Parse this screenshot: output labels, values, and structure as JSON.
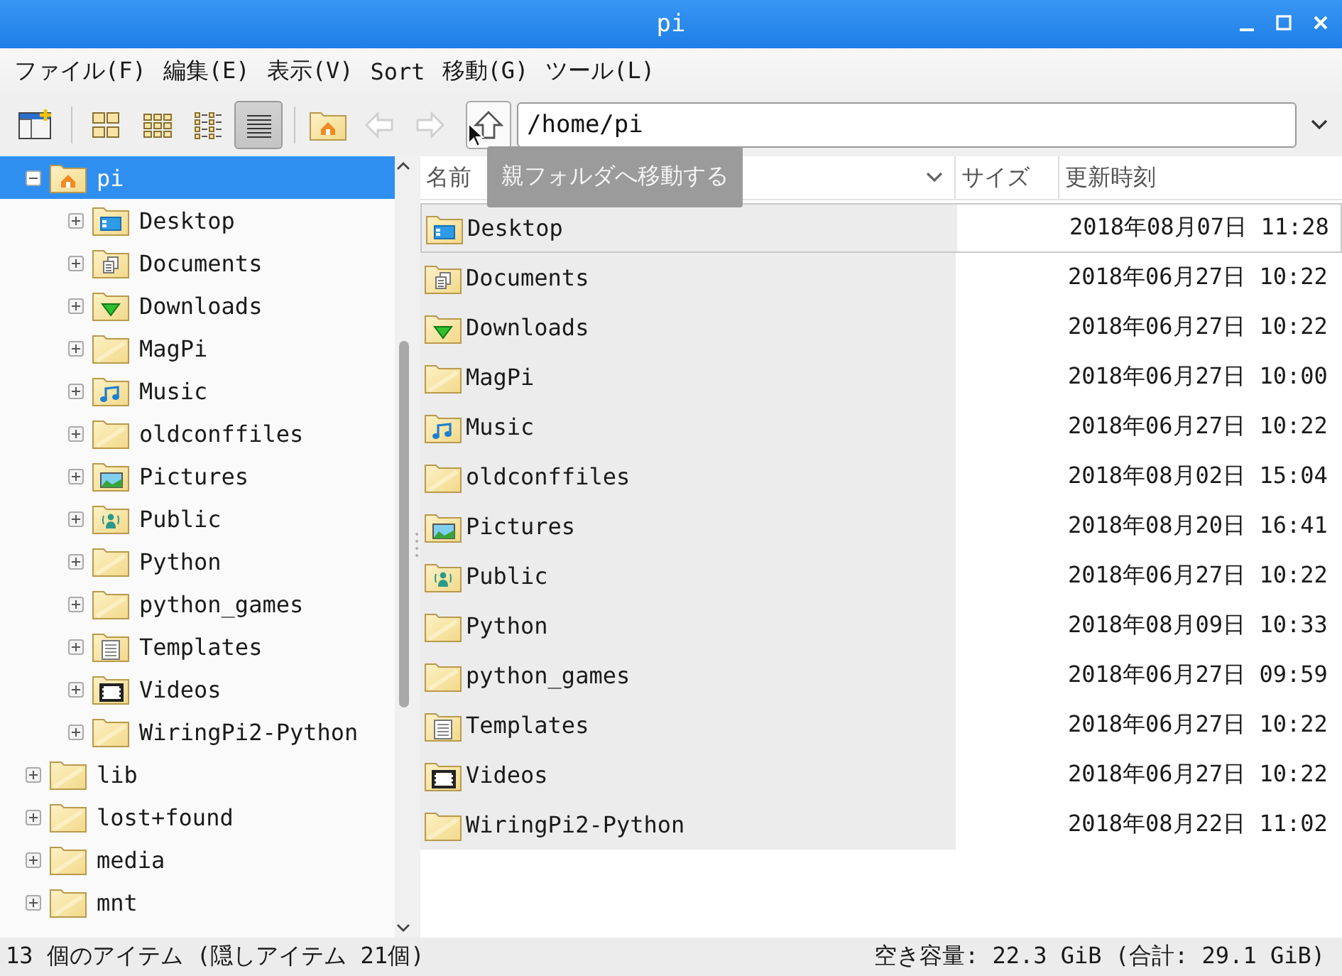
{
  "window": {
    "title": "pi"
  },
  "menu": [
    "ファイル(F)",
    "編集(E)",
    "表示(V)",
    "Sort",
    "移動(G)",
    "ツール(L)"
  ],
  "toolbar": {
    "view_modes": [
      {
        "kind": "icons",
        "selected": false
      },
      {
        "kind": "thumbnails",
        "selected": false
      },
      {
        "kind": "compact",
        "selected": false
      },
      {
        "kind": "detailed",
        "selected": true
      }
    ],
    "back": {
      "disabled": true
    },
    "forward": {
      "disabled": true
    },
    "path": "/home/pi"
  },
  "tooltip": "親フォルダへ移動する",
  "tree": [
    {
      "label": "pi",
      "kind": "home",
      "expanded": true,
      "selected": true,
      "children": [
        {
          "label": "Desktop",
          "kind": "desktop",
          "expanded": false,
          "selected": false
        },
        {
          "label": "Documents",
          "kind": "documents",
          "expanded": false,
          "selected": false
        },
        {
          "label": "Downloads",
          "kind": "downloads",
          "expanded": false,
          "selected": false
        },
        {
          "label": "MagPi",
          "kind": "plain",
          "expanded": false,
          "selected": false
        },
        {
          "label": "Music",
          "kind": "music",
          "expanded": false,
          "selected": false
        },
        {
          "label": "oldconffiles",
          "kind": "plain",
          "expanded": false,
          "selected": false
        },
        {
          "label": "Pictures",
          "kind": "pictures",
          "expanded": false,
          "selected": false
        },
        {
          "label": "Public",
          "kind": "public",
          "expanded": false,
          "selected": false
        },
        {
          "label": "Python",
          "kind": "plain",
          "expanded": false,
          "selected": false
        },
        {
          "label": "python_games",
          "kind": "plain",
          "expanded": false,
          "selected": false
        },
        {
          "label": "Templates",
          "kind": "templates",
          "expanded": false,
          "selected": false
        },
        {
          "label": "Videos",
          "kind": "videos",
          "expanded": false,
          "selected": false
        },
        {
          "label": "WiringPi2-Python",
          "kind": "plain",
          "expanded": false,
          "selected": false
        }
      ]
    },
    {
      "label": "lib",
      "kind": "plain",
      "expanded": false,
      "selected": false
    },
    {
      "label": "lost+found",
      "kind": "plain",
      "expanded": false,
      "selected": false
    },
    {
      "label": "media",
      "kind": "plain",
      "expanded": false,
      "selected": false
    },
    {
      "label": "mnt",
      "kind": "plain",
      "expanded": false,
      "selected": false
    }
  ],
  "list": {
    "columns": [
      "名前",
      "サイズ",
      "更新時刻"
    ],
    "rows": [
      {
        "name": "Desktop",
        "kind": "desktop",
        "modified": "2018年08月07日 11:28",
        "focused": true
      },
      {
        "name": "Documents",
        "kind": "documents",
        "modified": "2018年06月27日 10:22",
        "focused": false
      },
      {
        "name": "Downloads",
        "kind": "downloads",
        "modified": "2018年06月27日 10:22",
        "focused": false
      },
      {
        "name": "MagPi",
        "kind": "plain",
        "modified": "2018年06月27日 10:00",
        "focused": false
      },
      {
        "name": "Music",
        "kind": "music",
        "modified": "2018年06月27日 10:22",
        "focused": false
      },
      {
        "name": "oldconffiles",
        "kind": "plain",
        "modified": "2018年08月02日 15:04",
        "focused": false
      },
      {
        "name": "Pictures",
        "kind": "pictures",
        "modified": "2018年08月20日 16:41",
        "focused": false
      },
      {
        "name": "Public",
        "kind": "public",
        "modified": "2018年06月27日 10:22",
        "focused": false
      },
      {
        "name": "Python",
        "kind": "plain",
        "modified": "2018年08月09日 10:33",
        "focused": false
      },
      {
        "name": "python_games",
        "kind": "plain",
        "modified": "2018年06月27日 09:59",
        "focused": false
      },
      {
        "name": "Templates",
        "kind": "templates",
        "modified": "2018年06月27日 10:22",
        "focused": false
      },
      {
        "name": "Videos",
        "kind": "videos",
        "modified": "2018年06月27日 10:22",
        "focused": false
      },
      {
        "name": "WiringPi2-Python",
        "kind": "plain",
        "modified": "2018年08月22日 11:02",
        "focused": false
      }
    ]
  },
  "status_bar": {
    "items": "13 個のアイテム (隠しアイテム 21個)",
    "free": "空き容量: 22.3 GiB (合計: 29.1 GiB)"
  }
}
